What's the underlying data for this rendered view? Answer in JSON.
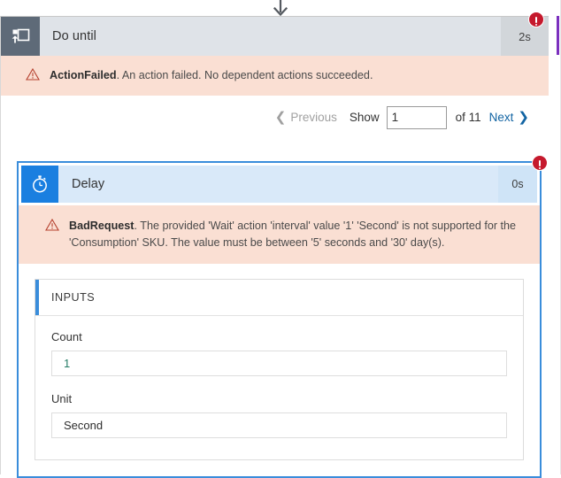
{
  "connector": {
    "icon": "down-arrow-icon"
  },
  "scope": {
    "icon": "do-until-loop-icon",
    "title": "Do until",
    "duration": "2s",
    "status_badge": "error-badge-icon",
    "error": {
      "icon": "warning-triangle-icon",
      "code": "ActionFailed",
      "message": ". An action failed. No dependent actions succeeded."
    }
  },
  "pager": {
    "previous_label": "Previous",
    "previous_icon": "chevron-left-icon",
    "show_label": "Show",
    "page_value": "1",
    "page_placeholder": "",
    "of_label": "of 11",
    "next_label": "Next",
    "next_icon": "chevron-right-icon"
  },
  "delay": {
    "icon": "stopwatch-icon",
    "title": "Delay",
    "duration": "0s",
    "status_badge": "error-badge-icon",
    "error": {
      "icon": "warning-triangle-icon",
      "code": "BadRequest",
      "message": ". The provided 'Wait' action 'interval' value '1' 'Second' is not supported for the 'Consumption' SKU. The value must be between '5' seconds and '30' day(s)."
    },
    "inputs": {
      "section_label": "INPUTS",
      "fields": [
        {
          "label": "Count",
          "value": "1",
          "type": "numeric"
        },
        {
          "label": "Unit",
          "value": "Second",
          "type": "text"
        }
      ]
    }
  },
  "colors": {
    "accent_blue": "#3a8ddb",
    "icon_blue": "#1a7fe0",
    "scope_header_gray": "#dfe3e8",
    "scope_icon_gray": "#5e6a78",
    "error_bg": "#fadfd3",
    "error_red": "#c5192d",
    "link_blue": "#1264a3",
    "value_green": "#267d66",
    "purple_strip": "#7b2fbe"
  }
}
